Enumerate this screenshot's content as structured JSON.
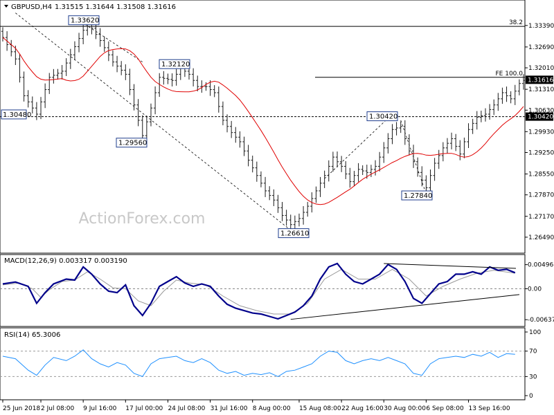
{
  "chart_data": [
    {
      "type": "candlestick",
      "title": "GBPUSD,H4",
      "ohlc_header": "1.31515 1.31644 1.31508 1.31616",
      "watermark": "ActionForex.com",
      "ylim": [
        1.2615,
        1.3395
      ],
      "y_ticks": [
        "1.33390",
        "1.32690",
        "1.32010",
        "1.31310",
        "1.30630",
        "1.29930",
        "1.29250",
        "1.28550",
        "1.27870",
        "1.27170",
        "1.26490"
      ],
      "current_price": "1.31616",
      "horizontal_levels": [
        {
          "label": "38.2",
          "value": 1.3336,
          "style": "solid"
        },
        {
          "label": "FE 100.0",
          "value": 1.317,
          "style": "solid"
        },
        {
          "label": "1.30420",
          "value": 1.3042,
          "style": "dashed"
        }
      ],
      "price_annotations": [
        {
          "label": "1.33620",
          "value": 1.3362
        },
        {
          "label": "1.32120",
          "value": 1.3212
        },
        {
          "label": "1.30480",
          "value": 1.3048
        },
        {
          "label": "1.29560",
          "value": 1.2956
        },
        {
          "label": "1.30420",
          "value": 1.3042
        },
        {
          "label": "1.27840",
          "value": 1.2784
        },
        {
          "label": "1.26610",
          "value": 1.2661
        }
      ],
      "close_anchors": [
        [
          0,
          1.33
        ],
        [
          3,
          1.323
        ],
        [
          5,
          1.311
        ],
        [
          8,
          1.305
        ],
        [
          11,
          1.317
        ],
        [
          14,
          1.319
        ],
        [
          17,
          1.327
        ],
        [
          20,
          1.335
        ],
        [
          23,
          1.329
        ],
        [
          26,
          1.322
        ],
        [
          29,
          1.318
        ],
        [
          31,
          1.308
        ],
        [
          33,
          1.298
        ],
        [
          35,
          1.307
        ],
        [
          37,
          1.317
        ],
        [
          40,
          1.316
        ],
        [
          42,
          1.32
        ],
        [
          44,
          1.318
        ],
        [
          46,
          1.314
        ],
        [
          48,
          1.314
        ],
        [
          50,
          1.312
        ],
        [
          52,
          1.303
        ],
        [
          54,
          1.299
        ],
        [
          56,
          1.296
        ],
        [
          58,
          1.29
        ],
        [
          60,
          1.285
        ],
        [
          62,
          1.28
        ],
        [
          64,
          1.277
        ],
        [
          66,
          1.272
        ],
        [
          68,
          1.269
        ],
        [
          70,
          1.271
        ],
        [
          72,
          1.275
        ],
        [
          74,
          1.28
        ],
        [
          76,
          1.285
        ],
        [
          78,
          1.291
        ],
        [
          80,
          1.288
        ],
        [
          82,
          1.283
        ],
        [
          84,
          1.287
        ],
        [
          86,
          1.286
        ],
        [
          88,
          1.288
        ],
        [
          90,
          1.294
        ],
        [
          92,
          1.3
        ],
        [
          94,
          1.301
        ],
        [
          96,
          1.293
        ],
        [
          98,
          1.286
        ],
        [
          100,
          1.281
        ],
        [
          102,
          1.289
        ],
        [
          104,
          1.294
        ],
        [
          106,
          1.297
        ],
        [
          108,
          1.292
        ],
        [
          110,
          1.3
        ],
        [
          112,
          1.304
        ],
        [
          114,
          1.305
        ],
        [
          116,
          1.308
        ],
        [
          118,
          1.312
        ],
        [
          120,
          1.31
        ],
        [
          122,
          1.315
        ],
        [
          123,
          1.316
        ]
      ],
      "x_tick_labels": [
        {
          "bar": 0,
          "label": "25 Jun 2018"
        },
        {
          "bar": 9,
          "label": "2 Jul 08:00"
        },
        {
          "bar": 19,
          "label": "9 Jul 16:00"
        },
        {
          "bar": 29,
          "label": "17 Jul 00:00"
        },
        {
          "bar": 39,
          "label": "24 Jul 08:00"
        },
        {
          "bar": 49,
          "label": "31 Jul 16:00"
        },
        {
          "bar": 59,
          "label": "8 Aug 00:00"
        },
        {
          "bar": 70,
          "label": "15 Aug 08:00"
        },
        {
          "bar": 80,
          "label": "22 Aug 16:00"
        },
        {
          "bar": 90,
          "label": "30 Aug 00:00"
        },
        {
          "bar": 100,
          "label": "6 Sep 08:00"
        },
        {
          "bar": 110,
          "label": "13 Sep 16:00"
        }
      ]
    },
    {
      "type": "line",
      "title": "MACD(12,26,9) 0.003317 0.003190",
      "ylim": [
        -0.0072,
        0.0062
      ],
      "y_ticks": [
        "0.004968",
        "0.00",
        "-0.006372"
      ],
      "macd": [
        [
          0,
          0.001
        ],
        [
          3,
          0.0014
        ],
        [
          6,
          0.0005
        ],
        [
          8,
          -0.003
        ],
        [
          10,
          -0.0008
        ],
        [
          12,
          0.001
        ],
        [
          15,
          0.002
        ],
        [
          17,
          0.0018
        ],
        [
          19,
          0.0045
        ],
        [
          21,
          0.003
        ],
        [
          23,
          0.001
        ],
        [
          25,
          -0.0005
        ],
        [
          27,
          -0.0008
        ],
        [
          29,
          0.0008
        ],
        [
          31,
          -0.0035
        ],
        [
          33,
          -0.0055
        ],
        [
          35,
          -0.003
        ],
        [
          37,
          0.0005
        ],
        [
          39,
          0.0015
        ],
        [
          41,
          0.0025
        ],
        [
          43,
          0.0012
        ],
        [
          45,
          0.0005
        ],
        [
          47,
          0.001
        ],
        [
          49,
          0.0005
        ],
        [
          51,
          -0.0015
        ],
        [
          53,
          -0.0032
        ],
        [
          55,
          -0.004
        ],
        [
          57,
          -0.0045
        ],
        [
          59,
          -0.005
        ],
        [
          61,
          -0.0052
        ],
        [
          63,
          -0.0057
        ],
        [
          65,
          -0.0062
        ],
        [
          67,
          -0.0055
        ],
        [
          69,
          -0.0048
        ],
        [
          71,
          -0.0035
        ],
        [
          73,
          -0.0015
        ],
        [
          75,
          0.002
        ],
        [
          77,
          0.0045
        ],
        [
          79,
          0.0052
        ],
        [
          81,
          0.003
        ],
        [
          83,
          0.0015
        ],
        [
          85,
          0.001
        ],
        [
          87,
          0.002
        ],
        [
          89,
          0.003
        ],
        [
          91,
          0.005
        ],
        [
          93,
          0.004
        ],
        [
          95,
          0.0015
        ],
        [
          97,
          -0.002
        ],
        [
          99,
          -0.003
        ],
        [
          101,
          -0.001
        ],
        [
          103,
          0.001
        ],
        [
          105,
          0.0015
        ],
        [
          107,
          0.003
        ],
        [
          109,
          0.003
        ],
        [
          111,
          0.0035
        ],
        [
          113,
          0.003
        ],
        [
          115,
          0.0045
        ],
        [
          117,
          0.0038
        ],
        [
          119,
          0.004
        ],
        [
          121,
          0.0033
        ]
      ],
      "signal": [
        [
          0,
          0.0008
        ],
        [
          4,
          0.0012
        ],
        [
          7,
          0.0
        ],
        [
          9,
          -0.0018
        ],
        [
          11,
          -0.0002
        ],
        [
          14,
          0.0015
        ],
        [
          17,
          0.0018
        ],
        [
          20,
          0.0035
        ],
        [
          23,
          0.002
        ],
        [
          26,
          0.0002
        ],
        [
          29,
          0.0
        ],
        [
          32,
          -0.0025
        ],
        [
          35,
          -0.0035
        ],
        [
          38,
          -0.0005
        ],
        [
          41,
          0.0018
        ],
        [
          44,
          0.0012
        ],
        [
          48,
          0.0008
        ],
        [
          52,
          -0.0015
        ],
        [
          56,
          -0.0035
        ],
        [
          60,
          -0.0045
        ],
        [
          64,
          -0.0052
        ],
        [
          68,
          -0.0052
        ],
        [
          72,
          -0.003
        ],
        [
          76,
          0.002
        ],
        [
          80,
          0.004
        ],
        [
          84,
          0.002
        ],
        [
          88,
          0.002
        ],
        [
          92,
          0.004
        ],
        [
          96,
          0.002
        ],
        [
          100,
          -0.0015
        ],
        [
          104,
          0.0005
        ],
        [
          108,
          0.002
        ],
        [
          112,
          0.0032
        ],
        [
          116,
          0.0038
        ],
        [
          121,
          0.0032
        ]
      ]
    },
    {
      "type": "line",
      "title": "RSI(14) 65.3006",
      "ylim": [
        0,
        100
      ],
      "y_ticks": [
        "100",
        "70",
        "30",
        "0"
      ],
      "rsi": [
        [
          0,
          62
        ],
        [
          3,
          58
        ],
        [
          6,
          40
        ],
        [
          8,
          32
        ],
        [
          10,
          48
        ],
        [
          12,
          60
        ],
        [
          15,
          55
        ],
        [
          17,
          62
        ],
        [
          19,
          72
        ],
        [
          21,
          58
        ],
        [
          23,
          50
        ],
        [
          25,
          45
        ],
        [
          27,
          52
        ],
        [
          29,
          48
        ],
        [
          31,
          35
        ],
        [
          33,
          30
        ],
        [
          35,
          50
        ],
        [
          37,
          58
        ],
        [
          39,
          60
        ],
        [
          41,
          62
        ],
        [
          43,
          55
        ],
        [
          45,
          52
        ],
        [
          47,
          58
        ],
        [
          49,
          52
        ],
        [
          51,
          40
        ],
        [
          53,
          35
        ],
        [
          55,
          38
        ],
        [
          57,
          32
        ],
        [
          59,
          35
        ],
        [
          61,
          33
        ],
        [
          63,
          36
        ],
        [
          65,
          30
        ],
        [
          67,
          38
        ],
        [
          69,
          40
        ],
        [
          71,
          45
        ],
        [
          73,
          50
        ],
        [
          75,
          62
        ],
        [
          77,
          70
        ],
        [
          79,
          68
        ],
        [
          81,
          55
        ],
        [
          83,
          50
        ],
        [
          85,
          55
        ],
        [
          87,
          58
        ],
        [
          89,
          55
        ],
        [
          91,
          60
        ],
        [
          93,
          55
        ],
        [
          95,
          50
        ],
        [
          97,
          35
        ],
        [
          99,
          32
        ],
        [
          101,
          50
        ],
        [
          103,
          58
        ],
        [
          105,
          60
        ],
        [
          107,
          62
        ],
        [
          109,
          60
        ],
        [
          111,
          65
        ],
        [
          113,
          62
        ],
        [
          115,
          68
        ],
        [
          117,
          60
        ],
        [
          119,
          66
        ],
        [
          121,
          65
        ]
      ]
    }
  ]
}
